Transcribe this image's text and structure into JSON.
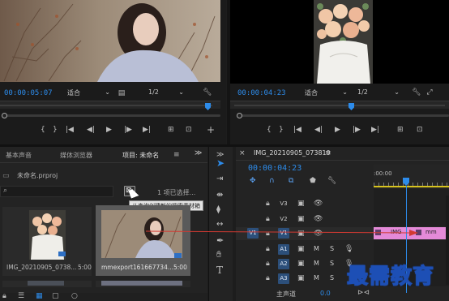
{
  "source_monitor": {
    "timecode": "00:00:05:07",
    "fit_label": "适合",
    "ratio_label": "1/2"
  },
  "program_monitor": {
    "timecode": "00:00:04:23",
    "fit_label": "适合",
    "ratio_label": "1/2"
  },
  "project_panel": {
    "tabs": [
      "基本声音",
      "媒体浏览器",
      "项目: 未命名"
    ],
    "more_label": "≫",
    "project_file": "未命名.prproj",
    "selection_info": "1 项已选择...",
    "tooltip": "从查询创建新的搜索素材箱",
    "items": [
      {
        "name": "IMG_20210905_0738...",
        "duration": "5:00"
      },
      {
        "name": "mmexport161667734...",
        "duration": "5:00"
      }
    ]
  },
  "timeline": {
    "tab": "IMG_20210905_073819",
    "timecode": "00:00:04:23",
    "ruler_label": ":00:00",
    "tracks": [
      {
        "name": "V3",
        "type": "video"
      },
      {
        "name": "V2",
        "type": "video"
      },
      {
        "name": "V1",
        "type": "video",
        "source": "V1"
      },
      {
        "name": "A1",
        "type": "audio",
        "source": "A1"
      },
      {
        "name": "A2",
        "type": "audio"
      },
      {
        "name": "A3",
        "type": "audio"
      }
    ],
    "mute_label": "M",
    "solo_label": "S",
    "master_label": "主声道",
    "master_value": "0.0",
    "clip_label_1": "IMG",
    "clip_label_2": "mm"
  },
  "watermark": "最需教育",
  "colors": {
    "accent": "#2d8ceb",
    "clip_pink": "#e48ad8",
    "playhead": "#2d8ceb",
    "arrow_red": "#d23a32"
  }
}
